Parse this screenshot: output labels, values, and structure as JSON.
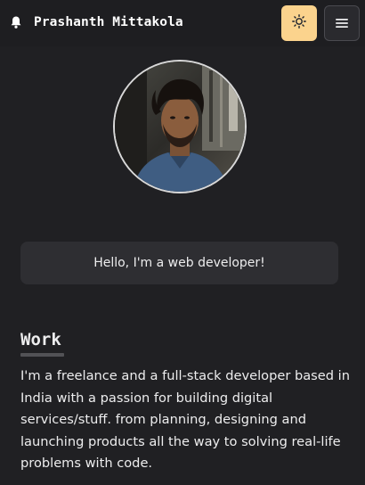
{
  "header": {
    "brand_icon": "bell-icon",
    "brand_name": "Prashanth Mittakola",
    "theme_toggle_icon": "sun-icon",
    "menu_icon": "hamburger-menu-icon"
  },
  "colors": {
    "background": "#202023",
    "theme_toggle": "#fbd38d",
    "card": "#2e2e32",
    "text": "#ededee"
  },
  "profile": {
    "avatar": "profile-photo"
  },
  "greeting": "Hello, I'm a web developer!",
  "work": {
    "title": "Work",
    "body": "I'm a freelance and a full-stack developer based in India with a passion for building digital services/stuff. from planning, designing and launching products all the way to solving real-life problems with code."
  }
}
